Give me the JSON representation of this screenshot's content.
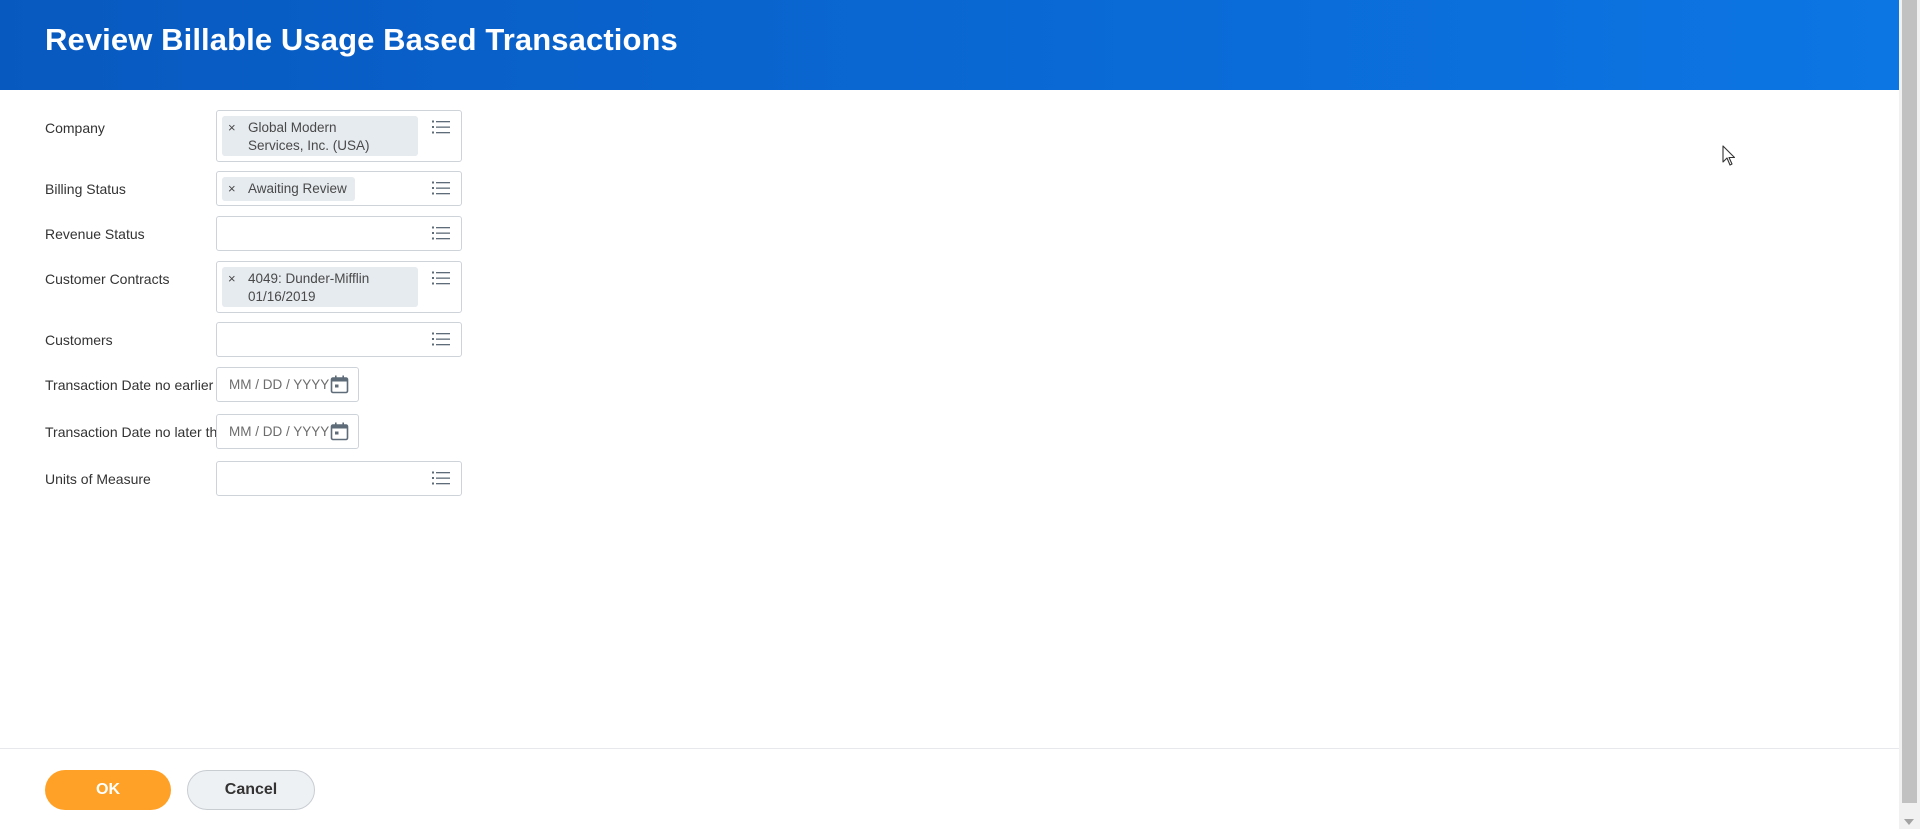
{
  "header": {
    "title": "Review Billable Usage Based Transactions"
  },
  "form": {
    "company": {
      "label": "Company",
      "value_line1": "Global Modern",
      "value_line2": "Services, Inc. (USA)"
    },
    "billing_status": {
      "label": "Billing Status",
      "value": "Awaiting Review"
    },
    "revenue_status": {
      "label": "Revenue Status"
    },
    "customer_contracts": {
      "label": "Customer Contracts",
      "value_line1": "4049: Dunder-Mifflin",
      "value_line2": "01/16/2019"
    },
    "customers": {
      "label": "Customers"
    },
    "date_from": {
      "label": "Transaction Date no earlier than",
      "placeholder": "MM / DD / YYYY"
    },
    "date_to": {
      "label": "Transaction Date no later than",
      "placeholder": "MM / DD / YYYY"
    },
    "units": {
      "label": "Units of Measure"
    },
    "remove_glyph": "×"
  },
  "footer": {
    "ok_label": "OK",
    "cancel_label": "Cancel"
  },
  "colors": {
    "header": "#0a6ad6",
    "primary_button": "#ffa126"
  },
  "icons": [
    "prompt-list-icon",
    "calendar-icon",
    "remove-icon",
    "mouse-cursor-icon"
  ]
}
